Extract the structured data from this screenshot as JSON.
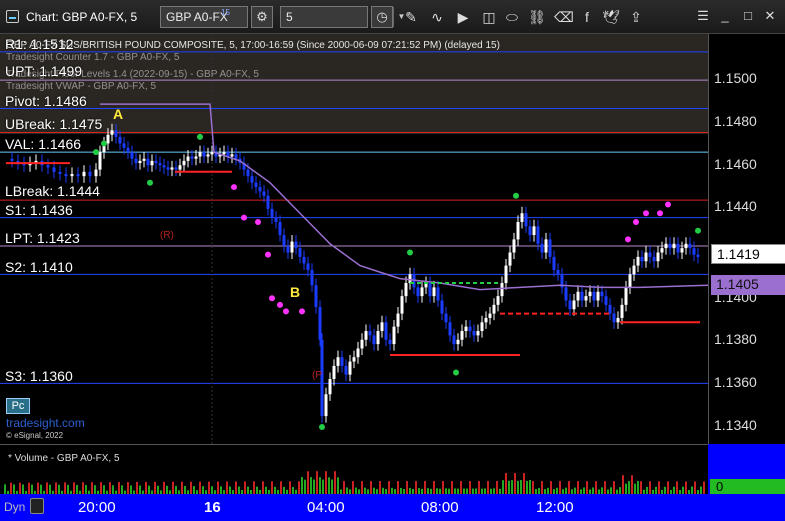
{
  "window": {
    "title": "Chart: GBP A0-FX, 5",
    "symbol": "GBP A0-FX",
    "symbol_sup": "15",
    "interval": "5"
  },
  "legend": {
    "line1": "GBP A0-FX $US/BRITISH POUND COMPOSITE, 5, 17:00-16:59 (Since 2000-06-09 07:21:52 PM) (delayed 15)",
    "line2": "Tradesight Counter 1.7 - GBP A0-FX, 5",
    "line3": "Tradesight Floor Levels 1.4 (2022-09-15) - GBP A0-FX, 5",
    "line4": "Tradesight VWAP - GBP A0-FX, 5"
  },
  "levels": [
    {
      "label": "R1: 1.1512",
      "color": "#2244ff"
    },
    {
      "label": "UPT: 1.1499",
      "color": "#b48acc"
    },
    {
      "label": "Pivot: 1.1486",
      "color": "#2244ff"
    },
    {
      "label": "UBreak: 1.1475",
      "color": "#d22"
    },
    {
      "label": "VAL: 1.1466",
      "color": "#6cf"
    },
    {
      "label": "LBreak: 1.1444",
      "color": "#d22"
    },
    {
      "label": "S1: 1.1436",
      "color": "#2244ff"
    },
    {
      "label": "LPT: 1.1423",
      "color": "#b48acc"
    },
    {
      "label": "S2: 1.1410",
      "color": "#2244ff"
    },
    {
      "label": "S3: 1.1360",
      "color": "#2244ff"
    }
  ],
  "price_axis": {
    "ticks": [
      "1.1500",
      "1.1480",
      "1.1460",
      "1.1440",
      "1.1400",
      "1.1380",
      "1.1360",
      "1.1340"
    ],
    "last_price": "1.1419",
    "vwap_price": "1.1405"
  },
  "annotations": {
    "marker_a": "A",
    "marker_b": "B",
    "marker_r": "(R)",
    "marker_p": "(P"
  },
  "volume": {
    "label": "* Volume - GBP A0-FX, 5",
    "value": "0"
  },
  "time_axis": {
    "dyn": "Dyn",
    "ticks": [
      "20:00",
      "16",
      "04:00",
      "08:00",
      "12:00"
    ]
  },
  "footer": {
    "pc": "Pc",
    "watermark": "tradesight.com",
    "copyright": "© eSignal, 2022"
  },
  "colors": {
    "up_bar": "#ffffff",
    "down_bar": "#1a3cff",
    "vwap": "#9a6fd0",
    "counter_green": "#22cc44",
    "counter_magenta": "#ff33ff",
    "floor_red": "#ff2222",
    "floor_green": "#22cc44"
  }
}
